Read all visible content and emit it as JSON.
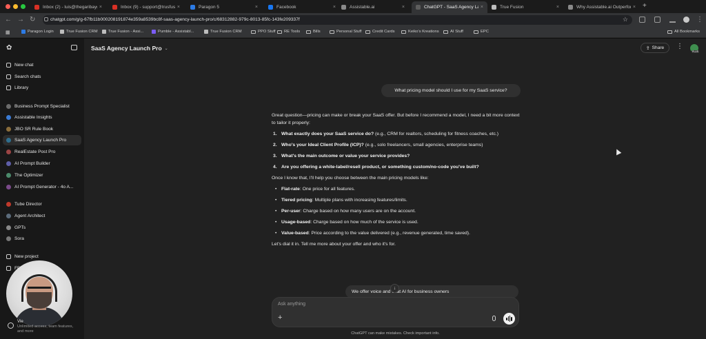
{
  "browser": {
    "tabs": [
      {
        "label": "Inbox (2) - luis@thegaribaygr",
        "icon": "gmail-icon",
        "color": "#d93025"
      },
      {
        "label": "Inbox (9) - support@trusfusi",
        "icon": "gmail-icon",
        "color": "#d93025"
      },
      {
        "label": "Paragon 5",
        "icon": "paragon-icon",
        "color": "#2c7be5"
      },
      {
        "label": "Facebook",
        "icon": "facebook-icon",
        "color": "#1877f2"
      },
      {
        "label": "Assistable.ai",
        "icon": "assistable-icon",
        "color": "#8a8a8a"
      },
      {
        "label": "ChatGPT - SaaS Agency Lau",
        "icon": "chatgpt-icon",
        "color": "#5d5d5d",
        "active": true
      },
      {
        "label": "True Fusion",
        "icon": "truefusion-icon",
        "color": "#bdbdbd"
      },
      {
        "label": "Why Assistable.ai Outperfor",
        "icon": "assistable-icon",
        "color": "#8a8a8a"
      }
    ],
    "url": "chatgpt.com/g/g-67fb11b000208191874e359a8539bc8f-saas-agency-launch-pro/c/68312882-979c-8013-85fc-143fe209337f",
    "bookmarks": [
      {
        "label": "Paragon Login",
        "type": "site",
        "color": "#2c7be5"
      },
      {
        "label": "True Fusion CRM",
        "type": "site",
        "color": "#bdbdbd"
      },
      {
        "label": "True Fusion - Assi...",
        "type": "site",
        "color": "#bdbdbd"
      },
      {
        "label": "Pumble - Assistabl...",
        "type": "site",
        "color": "#7b5cf5"
      },
      {
        "label": "True Fusion CRM",
        "type": "site",
        "color": "#bdbdbd"
      },
      {
        "label": "PPO Stuff",
        "type": "folder"
      },
      {
        "label": "RE Tools",
        "type": "folder"
      },
      {
        "label": "Bills",
        "type": "folder"
      },
      {
        "label": "Personal Stuff",
        "type": "folder"
      },
      {
        "label": "Credit Cards",
        "type": "folder"
      },
      {
        "label": "Keiko's Kreations",
        "type": "folder"
      },
      {
        "label": "AI Stuff",
        "type": "folder"
      },
      {
        "label": "EPC",
        "type": "folder"
      }
    ],
    "all_bookmarks": "All Bookmarks"
  },
  "sidebar": {
    "top_items": [
      {
        "label": "New chat",
        "icon": "new-chat-icon"
      },
      {
        "label": "Search chats",
        "icon": "search-icon"
      },
      {
        "label": "Library",
        "icon": "library-icon"
      }
    ],
    "gpts": [
      {
        "label": "Business Prompt Specialist",
        "icon": "gpt-avatar-icon"
      },
      {
        "label": "Assistable Insights",
        "icon": "gpt-avatar-icon"
      },
      {
        "label": "JBO SR Rule Book",
        "icon": "gpt-avatar-icon"
      },
      {
        "label": "SaaS Agency Launch Pro",
        "icon": "gpt-avatar-icon",
        "active": true
      },
      {
        "label": "RealEstate Post Pro",
        "icon": "gpt-avatar-icon"
      },
      {
        "label": "AI Prompt Builder",
        "icon": "gpt-avatar-icon"
      },
      {
        "label": "The Optimizer",
        "icon": "gpt-avatar-icon"
      },
      {
        "label": "AI Prompt Generator - 4o A...",
        "icon": "gpt-avatar-icon"
      }
    ],
    "more_items": [
      {
        "label": "Tube Director",
        "icon": "gpt-avatar-icon"
      },
      {
        "label": "Agent Architect",
        "icon": "gpt-avatar-icon"
      },
      {
        "label": "GPTs",
        "icon": "grid-icon"
      },
      {
        "label": "Sora",
        "icon": "sora-icon"
      }
    ],
    "projects": [
      {
        "label": "New project",
        "icon": "folder-plus-icon"
      },
      {
        "label": "FB",
        "icon": "folder-icon"
      }
    ],
    "upgrade": {
      "title": "Vie",
      "subtitle": "Unlimited access, team features, and more"
    }
  },
  "header": {
    "title": "SaaS Agency Launch Pro",
    "share_label": "Share",
    "avatar_badge": "PLUS"
  },
  "conversation": {
    "user_message": "What pricing model should I use for my SaaS service?",
    "intro": "Great question—pricing can make or break your SaaS offer. But before I recommend a model, I need a bit more context to tailor it properly:",
    "questions": [
      {
        "num": "1.",
        "bold": "What exactly does your SaaS service do?",
        "rest": " (e.g., CRM for realtors, scheduling for fitness coaches, etc.)"
      },
      {
        "num": "2.",
        "bold": "Who's your Ideal Client Profile (ICP)?",
        "rest": " (e.g., solo freelancers, small agencies, enterprise teams)"
      },
      {
        "num": "3.",
        "bold": "What's the main outcome or value your service provides?",
        "rest": ""
      },
      {
        "num": "4.",
        "bold": "Are you offering a white-label/resell product, or something custom/no-code you've built?",
        "rest": ""
      }
    ],
    "models_intro": "Once I know that, I'll help you choose between the main pricing models like:",
    "models": [
      {
        "bold": "Flat-rate",
        "rest": ": One price for all features."
      },
      {
        "bold": "Tiered pricing",
        "rest": ": Multiple plans with increasing features/limits."
      },
      {
        "bold": "Per-user",
        "rest": ": Charge based on how many users are on the account."
      },
      {
        "bold": "Usage-based",
        "rest": ": Charge based on how much of the service is used."
      },
      {
        "bold": "Value-based",
        "rest": ": Price according to the value delivered (e.g., revenue generated, time saved)."
      }
    ],
    "closing": "Let's dial it in. Tell me more about your offer and who it's for.",
    "pending_message": "We offer voice and chat AI for business owners"
  },
  "composer": {
    "placeholder": "Ask anything",
    "disclaimer": "ChatGPT can make mistakes. Check important info."
  }
}
